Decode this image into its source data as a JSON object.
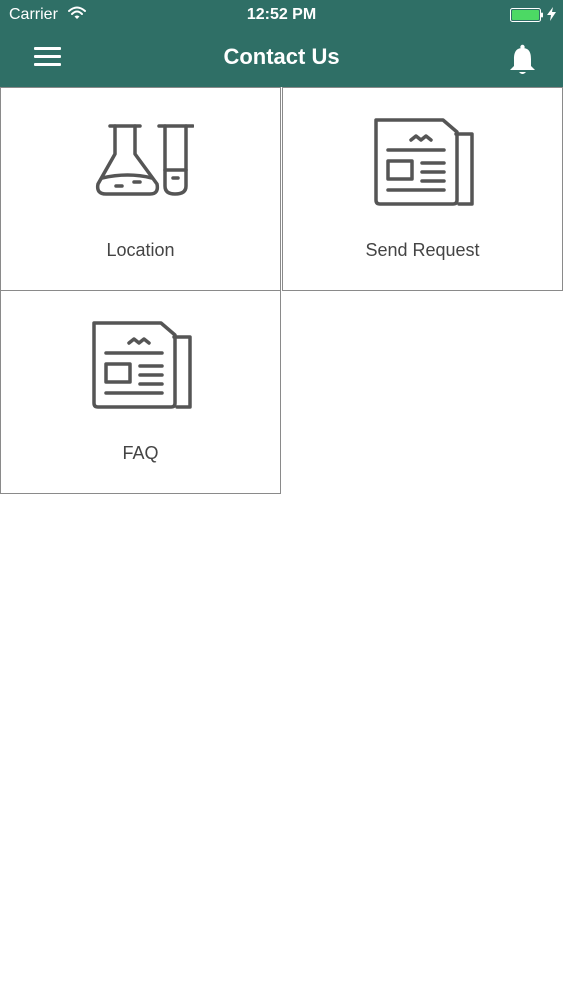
{
  "status_bar": {
    "carrier": "Carrier",
    "time": "12:52 PM",
    "icons": [
      "wifi-icon",
      "battery-icon",
      "charging-bolt-icon"
    ]
  },
  "header": {
    "title": "Contact Us",
    "menu_icon": "hamburger-menu-icon",
    "notification_icon": "bell-icon",
    "background_color": "#2f6f66"
  },
  "tiles": [
    {
      "label": "Location",
      "icon": "lab-flask-icon"
    },
    {
      "label": "Send Request",
      "icon": "newspaper-icon"
    },
    {
      "label": "FAQ",
      "icon": "newspaper-icon"
    }
  ],
  "colors": {
    "accent": "#2f6f66",
    "icon_stroke": "#555555",
    "tile_border": "#8a8a8a"
  }
}
